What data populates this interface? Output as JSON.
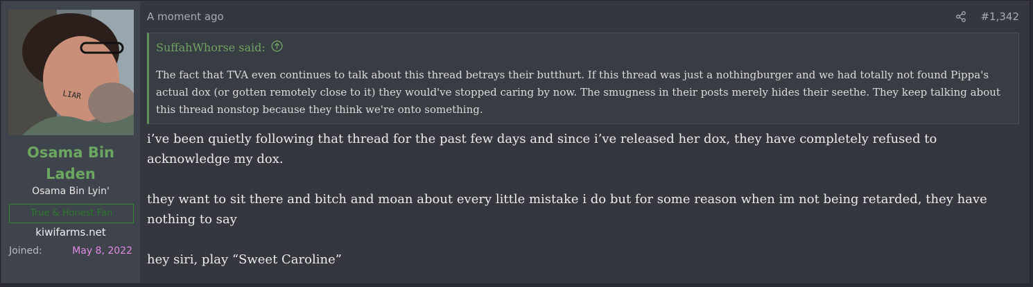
{
  "user": {
    "username": "Osama Bin Laden",
    "user_title": "Osama Bin Lyin'",
    "banner": "True & Honest Fan",
    "site": "kiwifarms.net",
    "joined_label": "Joined:",
    "joined_value": "May 8, 2022",
    "avatar_text": "LIAR"
  },
  "post": {
    "timestamp": "A moment ago",
    "post_number": "#1,342",
    "share_icon": "share-icon",
    "quote": {
      "author": "SuffahWhorse said:",
      "jump_icon": "arrow-up-circle-icon",
      "text": "The fact that TVA even continues to talk about this thread betrays their butthurt. If this thread was just a nothingburger and we had totally not found Pippa's actual dox (or gotten remotely close to it) they would've stopped caring by now. The smugness in their posts merely hides their seethe. They keep talking about this thread nonstop because they think we're onto something."
    },
    "paragraphs": [
      "i’ve been quietly following that thread for the past few days and since i’ve released her dox, they have completely refused to acknowledge my dox.",
      "they want to sit there and bitch and moan about every little mistake i do but for some reason when im not being retarded, they have nothing to say",
      "hey siri, play “Sweet Caroline”"
    ]
  }
}
